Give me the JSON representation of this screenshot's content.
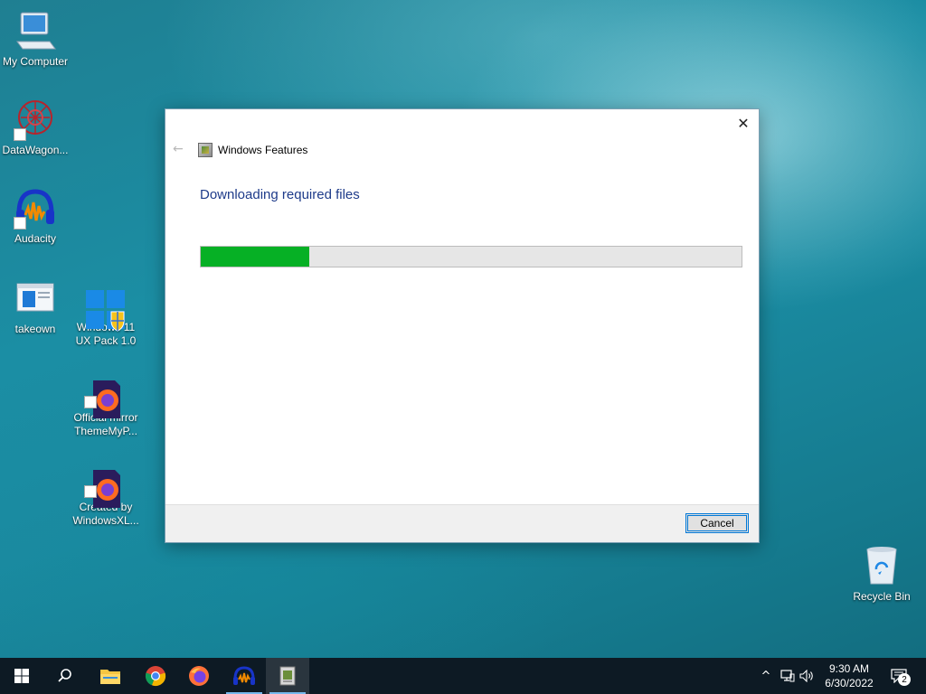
{
  "desktop": {
    "icons": [
      {
        "label": "My Computer"
      },
      {
        "label": "DataWagon..."
      },
      {
        "label": "Audacity"
      },
      {
        "label": "takeown"
      },
      {
        "label": "Windows 11\nUX Pack 1.0"
      },
      {
        "label": "Official mirror\nThemeMyP..."
      },
      {
        "label": "Created by\nWindowsXL..."
      },
      {
        "label": "Recycle Bin"
      }
    ]
  },
  "dialog": {
    "title": "Windows Features",
    "heading": "Downloading required files",
    "progress_percent": 20,
    "cancel_label": "Cancel",
    "close_glyph": "✕",
    "back_glyph": "←"
  },
  "taskbar": {
    "apps": [
      {
        "name": "start-icon"
      },
      {
        "name": "search-icon"
      },
      {
        "name": "file-explorer-icon"
      },
      {
        "name": "chrome-icon"
      },
      {
        "name": "firefox-icon"
      },
      {
        "name": "audacity-icon"
      },
      {
        "name": "windows-features-icon",
        "active": true
      }
    ],
    "clock_time": "9:30 AM",
    "clock_date": "6/30/2022",
    "notification_count": "2"
  },
  "colors": {
    "progress_fill": "#06b025",
    "heading_blue": "#1e3b8a",
    "accent": "#0078d7"
  }
}
